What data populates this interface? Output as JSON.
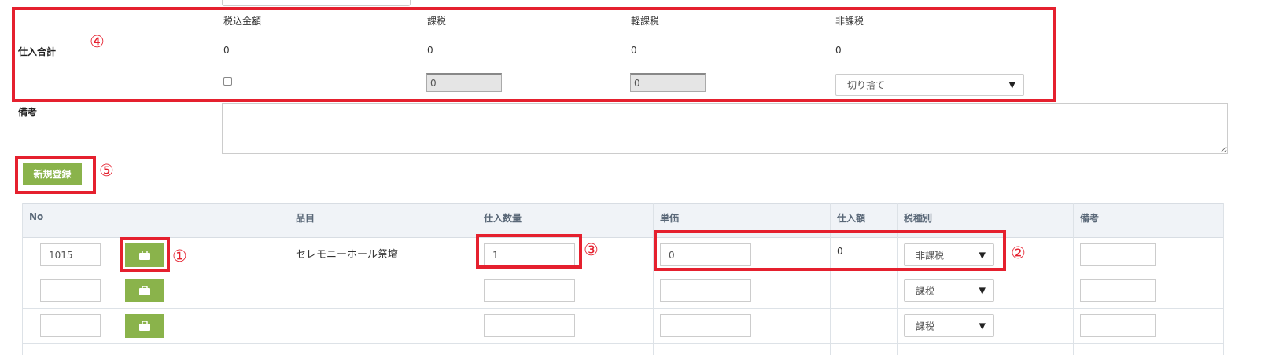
{
  "summary": {
    "label": "仕入合計",
    "columns": [
      {
        "header": "税込金額",
        "value": "0"
      },
      {
        "header": "課税",
        "value": "0"
      },
      {
        "header": "軽課税",
        "value": "0"
      },
      {
        "header": "非課税",
        "value": "0"
      }
    ],
    "tax_input": "0",
    "light_tax_input": "0",
    "rounding_select": "切り捨て"
  },
  "remarks": {
    "label": "備考",
    "value": ""
  },
  "new_register_label": "新規登録",
  "annotations": [
    "①",
    "②",
    "③",
    "④",
    "⑤"
  ],
  "table": {
    "headers": [
      "No",
      "品目",
      "仕入数量",
      "単価",
      "仕入額",
      "税種別",
      "備考"
    ],
    "rows": [
      {
        "no": "1015",
        "item": "セレモニーホール祭壇",
        "qty": "1",
        "unit_price": "0",
        "amount": "0",
        "tax_type": "非課税",
        "note": ""
      },
      {
        "no": "",
        "item": "",
        "qty": "",
        "unit_price": "",
        "amount": "",
        "tax_type": "課税",
        "note": ""
      },
      {
        "no": "",
        "item": "",
        "qty": "",
        "unit_price": "",
        "amount": "",
        "tax_type": "課税",
        "note": ""
      }
    ]
  },
  "colors": {
    "annotation_red": "#e5202e",
    "button_green": "#8ab34b"
  },
  "icons": {
    "row_button_icon": "briefcase-icon"
  }
}
